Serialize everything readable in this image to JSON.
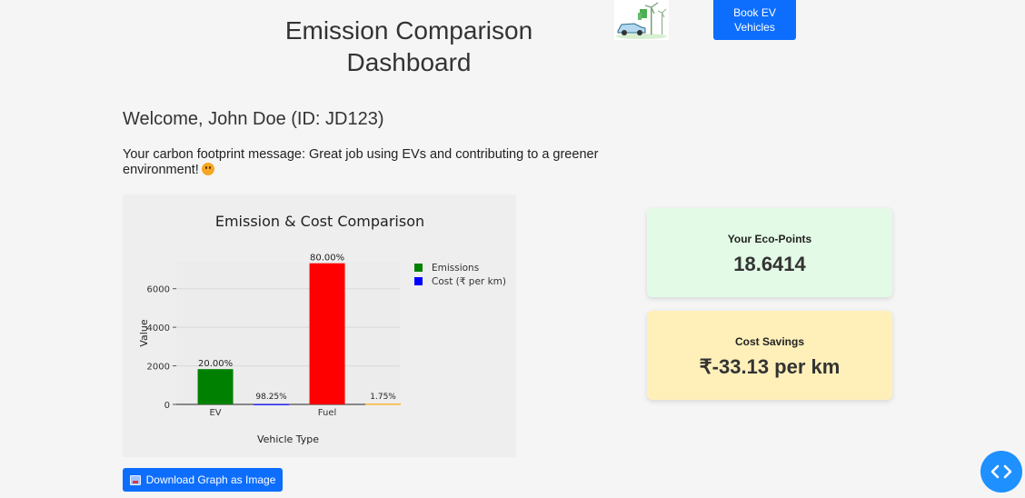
{
  "header": {
    "title_line1": "Emission Comparison",
    "title_line2": "Dashboard",
    "book_button_line1": "Book EV",
    "book_button_line2": "Vehicles"
  },
  "user": {
    "welcome": "Welcome, John Doe (ID: JD123)",
    "footprint_message": "Your carbon footprint message: Great job using EVs and contributing to a greener environment!"
  },
  "cards": {
    "eco_label": "Your Eco-Points",
    "eco_value": "18.6414",
    "cost_label": "Cost Savings",
    "cost_value": "₹-33.13 per km"
  },
  "download_button": "Download Graph as Image",
  "colors": {
    "accent": "#0d6efd",
    "emissions": "#008000",
    "fuel": "#ff0000",
    "cost": "#0000ff",
    "cost_fuel": "#ffa500"
  },
  "icons": {
    "logo": "ev-car-wind-turbine-icon",
    "download": "image-icon",
    "toggle": "code-chevrons-icon",
    "emoji": "smiling-face-icon"
  },
  "chart_data": {
    "type": "bar",
    "title": "Emission & Cost Comparison",
    "xlabel": "Vehicle Type",
    "ylabel": "Value",
    "categories": [
      "EV",
      "Fuel"
    ],
    "ylim": [
      0,
      7400
    ],
    "yticks": [
      0,
      2000,
      4000,
      6000
    ],
    "grid": true,
    "legend_position": "top-right",
    "series": [
      {
        "name": "Emissions",
        "color": "#008000",
        "values": [
          1830,
          7320
        ],
        "labels": [
          "20.00%",
          "80.00%"
        ]
      },
      {
        "name": "Cost (₹ per km)",
        "color": "#0000ff",
        "values": [
          18,
          33
        ],
        "labels": [
          "98.25%",
          "1.75%"
        ]
      }
    ]
  }
}
